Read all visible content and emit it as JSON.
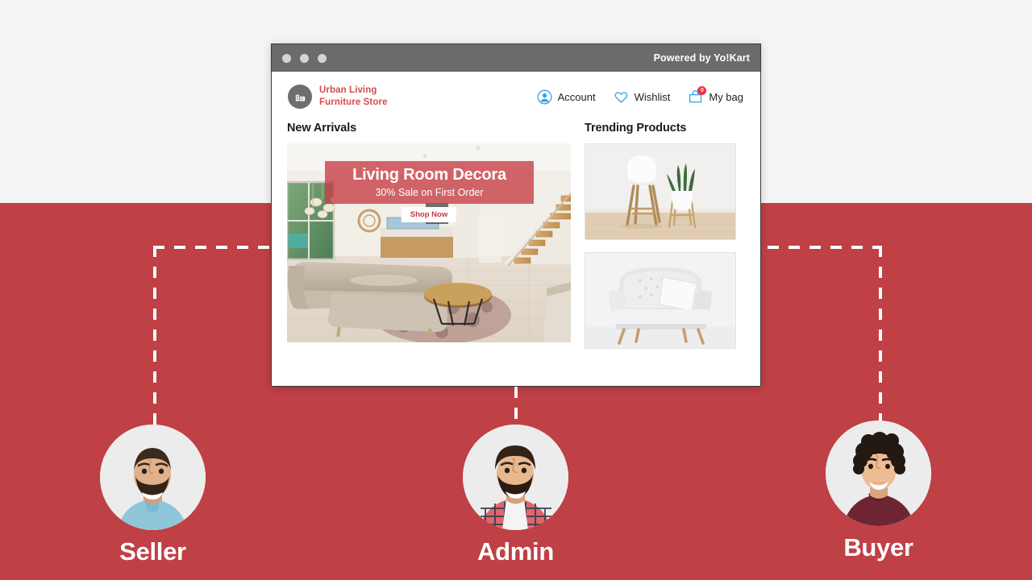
{
  "palette": {
    "background_top": "#f4f4f4",
    "background_bottom": "#bf4045",
    "brand_red": "#d94a4f",
    "overlay_red": "#c74046",
    "nav_icon_blue": "#29a3ee",
    "badge_red": "#ef2e45",
    "titlebar_gray": "#6b6b6b",
    "dot_gray": "#d4d4d4",
    "connector_white": "#ffffff"
  },
  "window": {
    "titlebar": {
      "dots": [
        "window-dot-1",
        "window-dot-2",
        "window-dot-3"
      ],
      "powered_by": "Powered by Yo!Kart"
    },
    "store_header": {
      "logo_icon": "storefront-building-icon",
      "brand_line_1": "Urban Living",
      "brand_line_2": "Furniture Store",
      "nav": [
        {
          "icon": "account-user-icon",
          "label": "Account"
        },
        {
          "icon": "wishlist-heart-icon",
          "label": "Wishlist"
        },
        {
          "icon": "shopping-bag-icon",
          "label": "My bag",
          "badge": "0"
        }
      ]
    },
    "sections": {
      "new_arrivals": {
        "title": "New Arrivals",
        "hero": {
          "image_alt": "modern-living-room-interior",
          "title": "Living Room Decora",
          "subtitle": "30% Sale on First Order",
          "cta_label": "Shop Now"
        }
      },
      "trending": {
        "title": "Trending Products",
        "products": [
          {
            "image_alt": "white-bar-stool-with-snake-plant"
          },
          {
            "image_alt": "white-tufted-armchair-with-pillow"
          }
        ]
      }
    }
  },
  "personas": [
    {
      "id": "seller",
      "label": "Seller",
      "avatar_alt": "bearded-man-in-light-blue-polo"
    },
    {
      "id": "admin",
      "label": "Admin",
      "avatar_alt": "bearded-man-in-plaid-shirt"
    },
    {
      "id": "buyer",
      "label": "Buyer",
      "avatar_alt": "young-man-with-curly-hair-in-maroon-shirt"
    }
  ]
}
